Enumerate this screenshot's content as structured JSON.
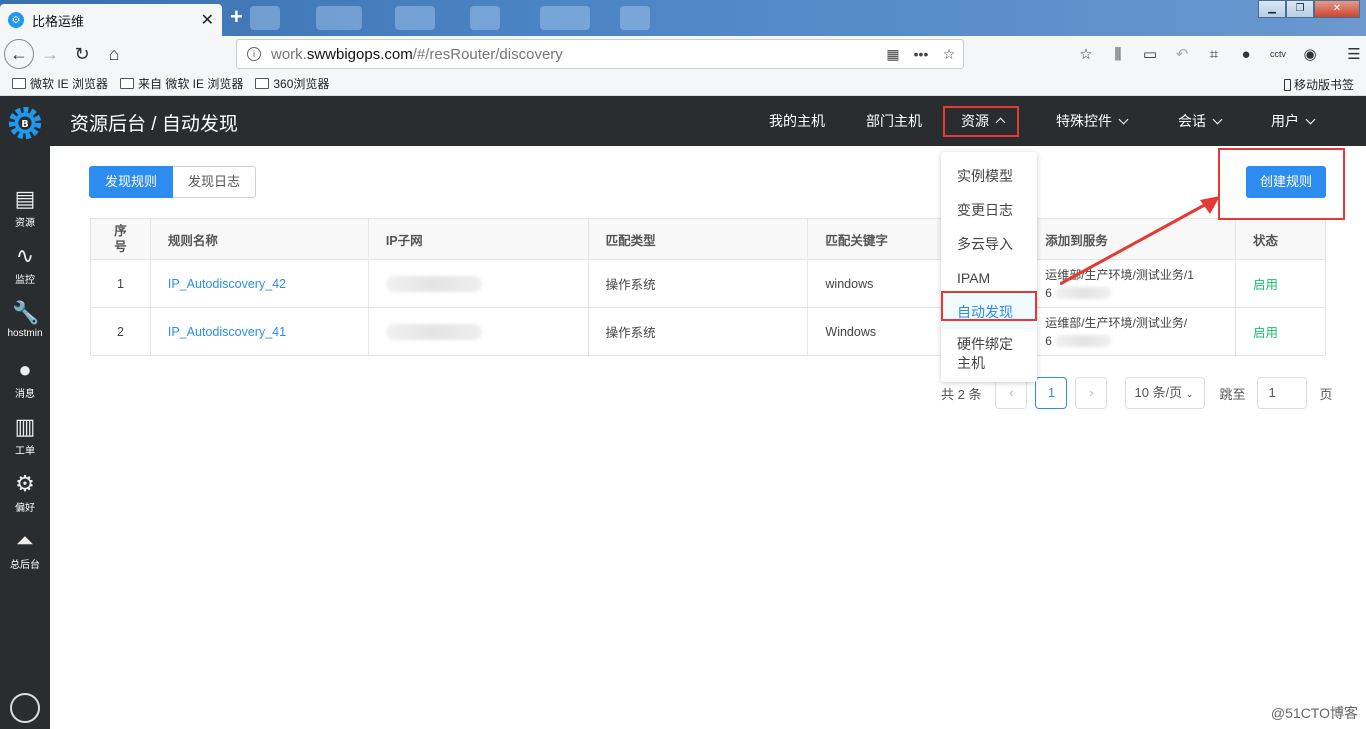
{
  "browser": {
    "tab_title": "比格运维",
    "tab_close": "✕",
    "new_tab": "+",
    "url_prefix": "work.",
    "url_domain": "swwbigops.com",
    "url_path": "/#/resRouter/discovery",
    "bookmarks": [
      "微软 IE 浏览器",
      "来自 微软 IE 浏览器",
      "360浏览器"
    ],
    "mobile_bookmarks": "移动版书签"
  },
  "app": {
    "breadcrumb": "资源后台 / 自动发现",
    "nav": [
      "我的主机",
      "部门主机",
      "资源",
      "特殊控件",
      "会话",
      "用户"
    ],
    "sidebar": [
      "资源",
      "监控",
      "hostmin",
      "消息",
      "工单",
      "偏好",
      "总后台"
    ]
  },
  "tabs": {
    "active": "发现规则",
    "inactive": "发现日志"
  },
  "create_button": "创建规则",
  "table": {
    "headers": [
      "序号",
      "规则名称",
      "IP子网",
      "匹配类型",
      "匹配关键字",
      "添加到服务",
      "状态"
    ],
    "seq_header_lines": [
      "序",
      "号"
    ],
    "rows": [
      {
        "no": "1",
        "name": "IP_Autodiscovery_42",
        "type": "操作系统",
        "keyword": "windows",
        "service_line1": "运维部/生产环境/测试业务/1",
        "service_line2": "6",
        "status": "启用"
      },
      {
        "no": "2",
        "name": "IP_Autodiscovery_41",
        "type": "操作系统",
        "keyword": "Windows",
        "service_line1": "运维部/生产环境/测试业务/",
        "service_line2": "6",
        "status": "启用"
      }
    ]
  },
  "pager": {
    "total": "共 2 条",
    "prev": "‹",
    "current": "1",
    "next": "›",
    "size": "10 条/页",
    "jump_label": "跳至",
    "jump_value": "1",
    "page_unit": "页"
  },
  "dropdown": [
    "实例模型",
    "变更日志",
    "多云导入",
    "IPAM",
    "自动发现",
    "硬件绑定主机"
  ],
  "dropdown_hw_lines": [
    "硬件绑定",
    "主机"
  ],
  "watermark": "@51CTO博客",
  "colors": {
    "primary": "#2d8cf0",
    "dark": "#2a2d30",
    "success": "#19be6b",
    "annotation": "#e53935"
  }
}
